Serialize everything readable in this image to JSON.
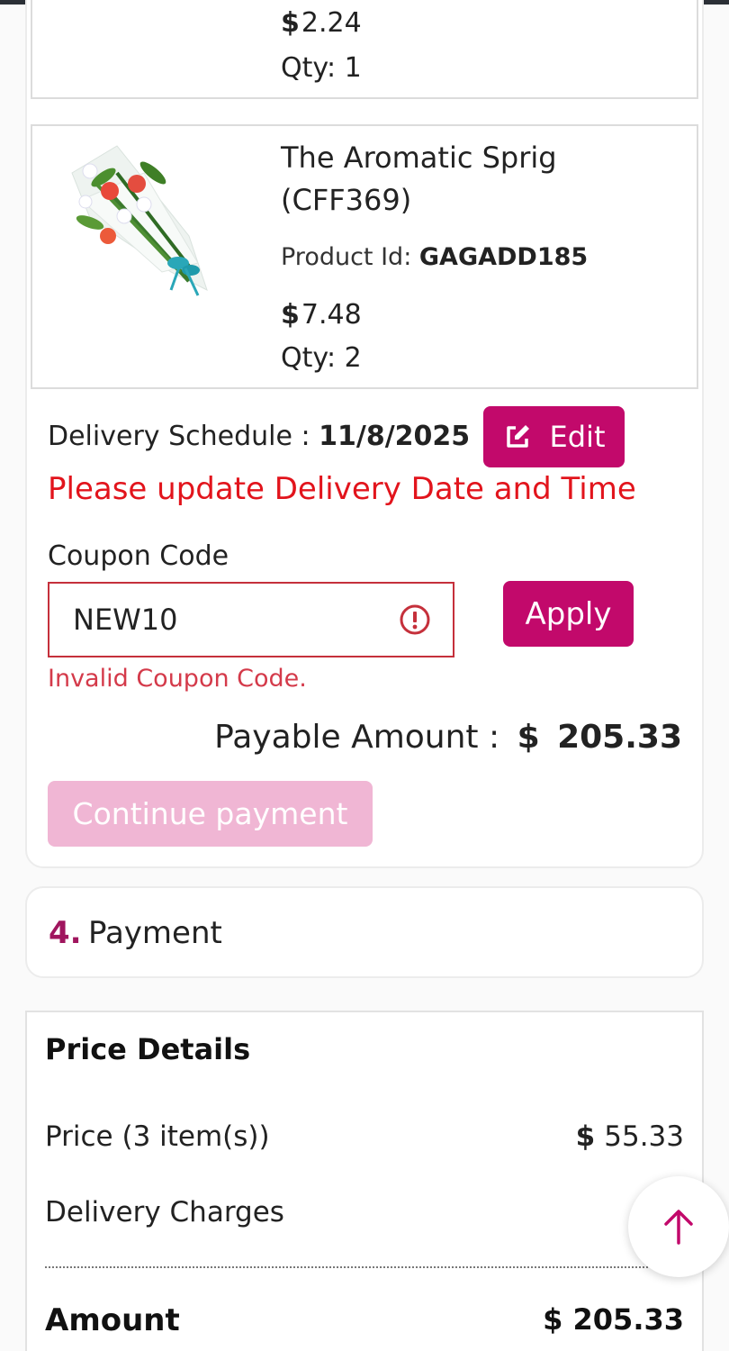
{
  "items": [
    {
      "currency": "$",
      "price": "2.24",
      "qty": "Qty: 1"
    },
    {
      "name": "The Aromatic Sprig (CFF369)",
      "product_id_label": "Product Id:",
      "product_id": "GAGADD185",
      "currency": "$",
      "price": "7.48",
      "qty": "Qty: 2",
      "image_icon": "flower-bouquet-image"
    }
  ],
  "delivery": {
    "label": "Delivery Schedule : ",
    "date": "11/8/2025",
    "edit_label": "Edit",
    "edit_icon": "edit-icon",
    "warning": "Please update Delivery Date and Time"
  },
  "coupon": {
    "label": "Coupon Code",
    "value": "NEW10",
    "apply_label": "Apply",
    "error": "Invalid Coupon Code.",
    "error_icon": "exclamation-circle-icon"
  },
  "payable": {
    "label": "Payable Amount : ",
    "currency": "$",
    "amount": "205.33"
  },
  "continue_label": "Continue payment",
  "payment_section": {
    "number": "4.",
    "title": "Payment"
  },
  "price_details": {
    "title": "Price Details",
    "price_label": "Price (3 item(s))",
    "price_currency": "$",
    "price_value": "55.33",
    "delivery_label": "Delivery Charges",
    "amount_label": "Amount",
    "amount_currency": "$",
    "amount_value": "205.33"
  },
  "fab_icon": "arrow-up-icon",
  "colors": {
    "brand": "#c2096b",
    "brand_disabled": "#f0b6d4",
    "error": "#e2141c",
    "section_number": "#a0155e"
  }
}
